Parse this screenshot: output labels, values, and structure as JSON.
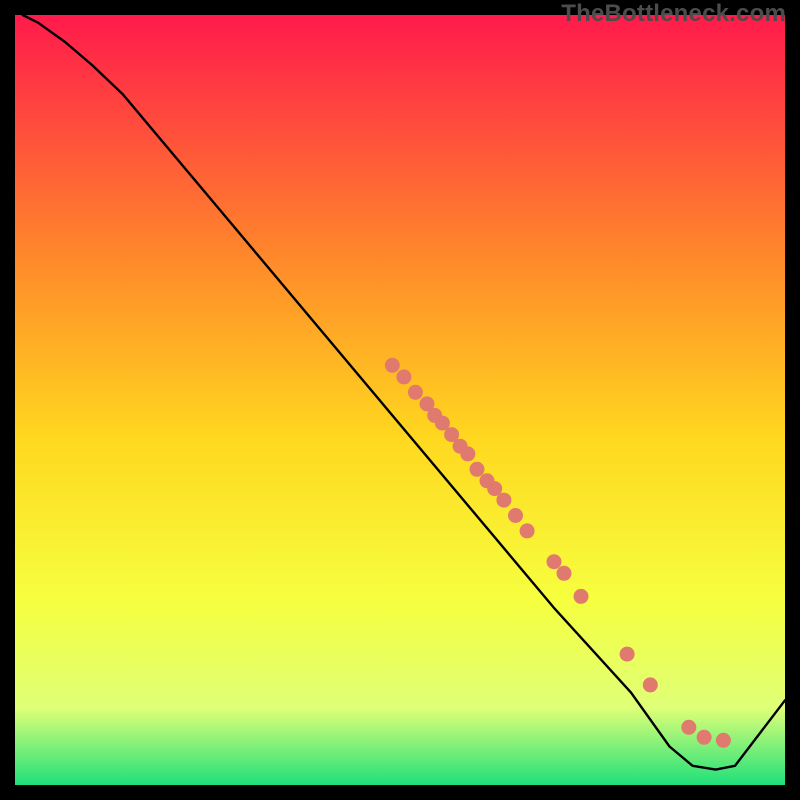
{
  "watermark": "TheBottleneck.com",
  "colors": {
    "grad_top": "#ff1a4b",
    "grad_upper_mid": "#ff8a2a",
    "grad_mid": "#ffd81f",
    "grad_lower_mid": "#f6ff3f",
    "grad_low": "#dfff77",
    "grad_bottom": "#1fe07a",
    "line": "#000000",
    "dot_fill": "#e07a6e",
    "dot_stroke": "#b84f45"
  },
  "chart_data": {
    "type": "line",
    "title": "",
    "xlabel": "",
    "ylabel": "",
    "xlim": [
      0,
      100
    ],
    "ylim": [
      0,
      100
    ],
    "grid": false,
    "legend": false,
    "curve": [
      {
        "x": 1.0,
        "y": 100.0
      },
      {
        "x": 3.0,
        "y": 99.0
      },
      {
        "x": 6.5,
        "y": 96.5
      },
      {
        "x": 10.0,
        "y": 93.5
      },
      {
        "x": 14.0,
        "y": 89.7
      },
      {
        "x": 70.0,
        "y": 23.0
      },
      {
        "x": 80.0,
        "y": 12.0
      },
      {
        "x": 85.0,
        "y": 5.0
      },
      {
        "x": 88.0,
        "y": 2.5
      },
      {
        "x": 91.0,
        "y": 2.0
      },
      {
        "x": 93.5,
        "y": 2.5
      },
      {
        "x": 100.0,
        "y": 11.0
      }
    ],
    "points": [
      {
        "x": 49.0,
        "y": 54.5
      },
      {
        "x": 50.5,
        "y": 53.0
      },
      {
        "x": 52.0,
        "y": 51.0
      },
      {
        "x": 53.5,
        "y": 49.5
      },
      {
        "x": 54.5,
        "y": 48.0
      },
      {
        "x": 55.5,
        "y": 47.0
      },
      {
        "x": 56.7,
        "y": 45.5
      },
      {
        "x": 57.8,
        "y": 44.0
      },
      {
        "x": 58.8,
        "y": 43.0
      },
      {
        "x": 60.0,
        "y": 41.0
      },
      {
        "x": 61.3,
        "y": 39.5
      },
      {
        "x": 62.3,
        "y": 38.5
      },
      {
        "x": 63.5,
        "y": 37.0
      },
      {
        "x": 65.0,
        "y": 35.0
      },
      {
        "x": 66.5,
        "y": 33.0
      },
      {
        "x": 70.0,
        "y": 29.0
      },
      {
        "x": 71.3,
        "y": 27.5
      },
      {
        "x": 73.5,
        "y": 24.5
      },
      {
        "x": 79.5,
        "y": 17.0
      },
      {
        "x": 82.5,
        "y": 13.0
      },
      {
        "x": 87.5,
        "y": 7.5
      },
      {
        "x": 89.5,
        "y": 6.2
      },
      {
        "x": 92.0,
        "y": 5.8
      }
    ]
  }
}
